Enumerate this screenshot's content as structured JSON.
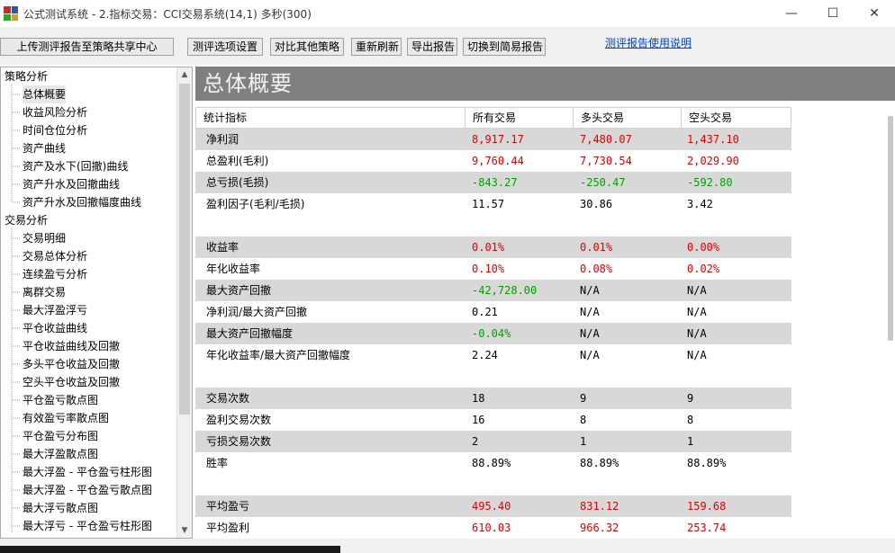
{
  "window": {
    "title": "公式测试系统 - 2.指标交易：CCI交易系统(14,1) 多秒(300)",
    "app_icon": "chart-app-icon",
    "controls": {
      "minimize": "—",
      "maximize": "☐",
      "close": "✕"
    }
  },
  "toolbar": {
    "upload": "上传测评报告至策略共享中心",
    "options": "测评选项设置",
    "compare": "对比其他策略",
    "refresh": "重新刷新",
    "export": "导出报告",
    "switch": "切换到简易报告",
    "help_link": "测评报告使用说明"
  },
  "tree": {
    "groups": [
      {
        "label": "策略分析",
        "items": [
          "总体概要",
          "收益风险分析",
          "时间仓位分析",
          "资产曲线",
          "资产及水下(回撤)曲线",
          "资产升水及回撤曲线",
          "资产升水及回撤幅度曲线"
        ]
      },
      {
        "label": "交易分析",
        "items": [
          "交易明细",
          "交易总体分析",
          "连续盈亏分析",
          "离群交易",
          "最大浮盈浮亏",
          "平仓收益曲线",
          "平仓收益曲线及回撤",
          "多头平仓收益及回撤",
          "空头平仓收益及回撤",
          "平仓盈亏散点图",
          "有效盈亏率散点图",
          "平仓盈亏分布图",
          "最大浮盈散点图",
          "最大浮盈 - 平仓盈亏柱形图",
          "最大浮盈 - 平仓盈亏散点图",
          "最大浮亏散点图",
          "最大浮亏 - 平仓盈亏柱形图"
        ]
      }
    ],
    "selected": "总体概要"
  },
  "main": {
    "banner": "总体概要",
    "headers": [
      "统计指标",
      "所有交易",
      "多头交易",
      "空头交易"
    ],
    "rows": [
      {
        "label": "净利润",
        "all": "8,917.17",
        "long": "7,480.07",
        "short": "1,437.10",
        "shade": true,
        "colors": [
          "red",
          "red",
          "red"
        ]
      },
      {
        "label": "总盈利(毛利)",
        "all": "9,760.44",
        "long": "7,730.54",
        "short": "2,029.90",
        "shade": false,
        "colors": [
          "red",
          "red",
          "red"
        ]
      },
      {
        "label": "总亏损(毛损)",
        "all": "-843.27",
        "long": "-250.47",
        "short": "-592.80",
        "shade": true,
        "colors": [
          "green",
          "green",
          "green"
        ]
      },
      {
        "label": "盈利因子(毛利/毛损)",
        "all": "11.57",
        "long": "30.86",
        "short": "3.42",
        "shade": false,
        "colors": [
          "black",
          "black",
          "black"
        ]
      },
      {
        "label": "",
        "all": "",
        "long": "",
        "short": "",
        "shade": false,
        "colors": [
          "black",
          "black",
          "black"
        ]
      },
      {
        "label": "收益率",
        "all": "0.01%",
        "long": "0.01%",
        "short": "0.00%",
        "shade": true,
        "colors": [
          "red",
          "red",
          "red"
        ]
      },
      {
        "label": "年化收益率",
        "all": "0.10%",
        "long": "0.08%",
        "short": "0.02%",
        "shade": false,
        "colors": [
          "red",
          "red",
          "red"
        ]
      },
      {
        "label": "最大资产回撤",
        "all": "-42,728.00",
        "long": "N/A",
        "short": "N/A",
        "shade": true,
        "colors": [
          "green",
          "black",
          "black"
        ]
      },
      {
        "label": "净利润/最大资产回撤",
        "all": "0.21",
        "long": "N/A",
        "short": "N/A",
        "shade": false,
        "colors": [
          "black",
          "black",
          "black"
        ]
      },
      {
        "label": "最大资产回撤幅度",
        "all": "-0.04%",
        "long": "N/A",
        "short": "N/A",
        "shade": true,
        "colors": [
          "green",
          "black",
          "black"
        ]
      },
      {
        "label": "年化收益率/最大资产回撤幅度",
        "all": "2.24",
        "long": "N/A",
        "short": "N/A",
        "shade": false,
        "colors": [
          "black",
          "black",
          "black"
        ]
      },
      {
        "label": "",
        "all": "",
        "long": "",
        "short": "",
        "shade": false,
        "colors": [
          "black",
          "black",
          "black"
        ]
      },
      {
        "label": "交易次数",
        "all": "18",
        "long": "9",
        "short": "9",
        "shade": true,
        "colors": [
          "black",
          "black",
          "black"
        ]
      },
      {
        "label": "盈利交易次数",
        "all": "16",
        "long": "8",
        "short": "8",
        "shade": false,
        "colors": [
          "black",
          "black",
          "black"
        ]
      },
      {
        "label": "亏损交易次数",
        "all": "2",
        "long": "1",
        "short": "1",
        "shade": true,
        "colors": [
          "black",
          "black",
          "black"
        ]
      },
      {
        "label": "胜率",
        "all": "88.89%",
        "long": "88.89%",
        "short": "88.89%",
        "shade": false,
        "colors": [
          "black",
          "black",
          "black"
        ]
      },
      {
        "label": "",
        "all": "",
        "long": "",
        "short": "",
        "shade": false,
        "colors": [
          "black",
          "black",
          "black"
        ]
      },
      {
        "label": "平均盈亏",
        "all": "495.40",
        "long": "831.12",
        "short": "159.68",
        "shade": true,
        "colors": [
          "red",
          "red",
          "red"
        ]
      },
      {
        "label": "平均盈利",
        "all": "610.03",
        "long": "966.32",
        "short": "253.74",
        "shade": false,
        "colors": [
          "red",
          "red",
          "red"
        ]
      }
    ]
  }
}
